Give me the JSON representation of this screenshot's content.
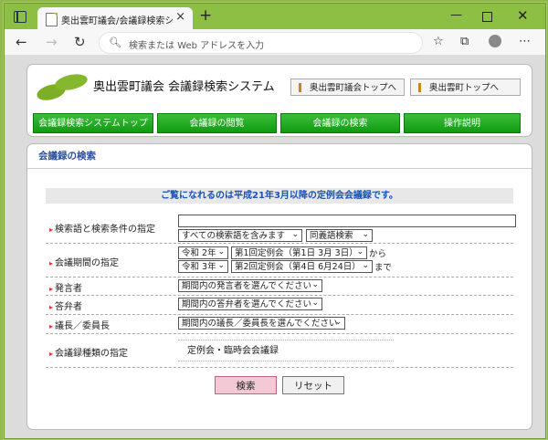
{
  "browser": {
    "tab_title": "奥出雲町議会/会議録検索システム",
    "tab_close": "×",
    "new_tab": "+",
    "address_placeholder": "検索または Web アドレスを入力"
  },
  "site": {
    "title": "奥出雲町議会  会議録検索システム",
    "top_links": [
      "奥出雲町議会トップへ",
      "奥出雲町トップへ"
    ],
    "nav": [
      "会議録検索システムトップ",
      "会議録の閲覧",
      "会議録の検索",
      "操作説明"
    ]
  },
  "search": {
    "heading": "会議録の検索",
    "notice": "ご覧になれるのは平成21年3月以降の定例会会議録です。",
    "rows": {
      "keyword": {
        "label": "検索語と検索条件の指定",
        "value": "",
        "option1": "すべての検索語を含みます",
        "option2": "同義語検索"
      },
      "period": {
        "label": "会議期間の指定",
        "from_year": "令和 2年",
        "from_session": "第1回定例会（第1日 3月 3日）",
        "from_suffix": "から",
        "to_year": "令和 3年",
        "to_session": "第2回定例会（第4日 6月24日）",
        "to_suffix": "まで"
      },
      "speaker": {
        "label": "発言者",
        "option": "期間内の発言者を選んでください"
      },
      "answerer": {
        "label": "答弁者",
        "option": "期間内の答弁者を選んでください"
      },
      "chair": {
        "label": "議長／委員長",
        "option": "期間内の議長／委員長を選んでください"
      },
      "kind": {
        "label": "会議録種類の指定",
        "value": "定例会・臨時会会議録"
      }
    },
    "buttons": {
      "search": "検索",
      "reset": "リセット"
    }
  }
}
